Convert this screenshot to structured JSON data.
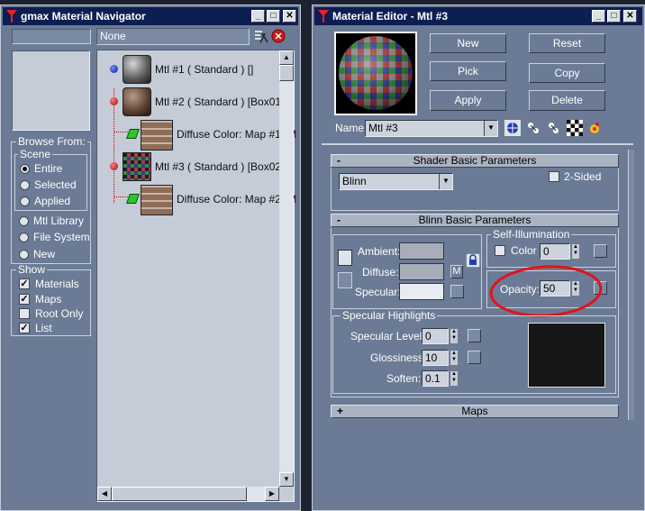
{
  "navigator": {
    "title": "gmax Material Navigator",
    "title_buttons": [
      "_",
      "□",
      "✕"
    ],
    "name_field": "None",
    "browse_from": {
      "label": "Browse From:",
      "scene_label": "Scene",
      "scene_options": [
        {
          "label": "Entire",
          "selected": true
        },
        {
          "label": "Selected",
          "selected": false
        },
        {
          "label": "Applied",
          "selected": false
        }
      ],
      "other_options": [
        {
          "label": "Mtl Library",
          "selected": false
        },
        {
          "label": "File System",
          "selected": false
        },
        {
          "label": "New",
          "selected": false
        }
      ]
    },
    "show": {
      "label": "Show",
      "options": [
        {
          "label": "Materials",
          "checked": true
        },
        {
          "label": "Maps",
          "checked": true
        },
        {
          "label": "Root Only",
          "checked": false
        },
        {
          "label": "List",
          "checked": true
        }
      ]
    },
    "tree": [
      {
        "label": "Mtl #1  ( Standard )  []"
      },
      {
        "label": "Mtl #2  ( Standard )  [Box01]"
      },
      {
        "label": "Diffuse Color: Map #1 (M"
      },
      {
        "label": "Mtl #3  ( Standard )  [Box02]"
      },
      {
        "label": "Diffuse Color: Map #2 (M"
      }
    ]
  },
  "editor": {
    "title": "Material Editor - Mtl #3",
    "title_buttons": [
      "_",
      "□",
      "✕"
    ],
    "buttons": {
      "new": "New",
      "reset": "Reset",
      "pick": "Pick",
      "copy": "Copy",
      "apply": "Apply",
      "delete": "Delete"
    },
    "name_label": "Name",
    "name_value": "Mtl #3",
    "shader_rollout": {
      "title": "Shader Basic Parameters",
      "toggle": "-",
      "shader": "Blinn",
      "two_sided_label": "2-Sided",
      "two_sided": false
    },
    "blinn_rollout": {
      "title": "Blinn Basic Parameters",
      "toggle": "-",
      "ambient_label": "Ambient:",
      "diffuse_label": "Diffuse:",
      "specular_label": "Specular:",
      "m_button": "M",
      "self_illum_label": "Self-Illumination",
      "color_label": "Color",
      "self_illum_value": "0",
      "opacity_label": "Opacity:",
      "opacity_value": "50",
      "spec_highlights_label": "Specular Highlights",
      "spec_level_label": "Specular Level:",
      "spec_level_value": "0",
      "glossiness_label": "Glossiness:",
      "glossiness_value": "10",
      "soften_label": "Soften:",
      "soften_value": "0.1"
    },
    "maps_rollout": {
      "title": "Maps",
      "toggle": "+"
    }
  },
  "colors": {
    "panel": "#6b7b95",
    "title_bar": "#0d1e52",
    "annotation": "#e0141a"
  }
}
